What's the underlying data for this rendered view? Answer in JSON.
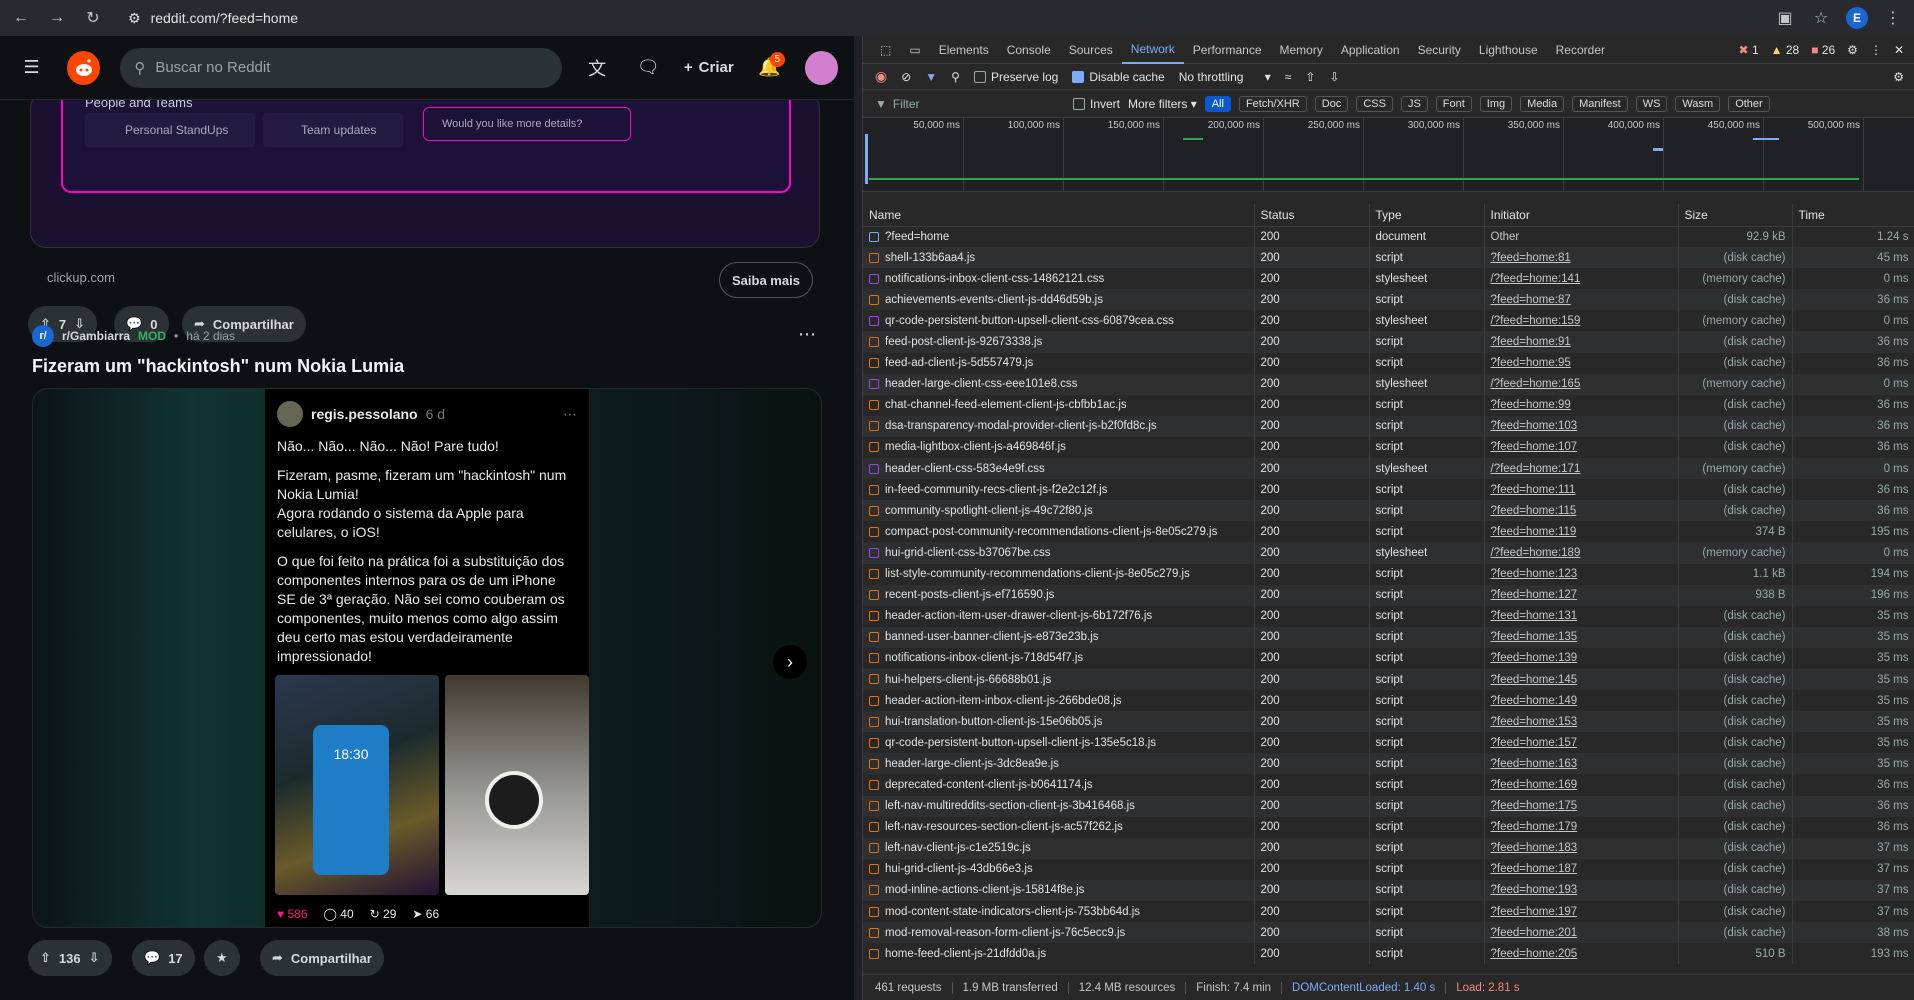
{
  "browser": {
    "url": "reddit.com/?feed=home",
    "profile_initial": "E"
  },
  "reddit": {
    "search_placeholder": "Buscar no Reddit",
    "create_label": "Criar",
    "notif_count": "5",
    "ad": {
      "section_label": "People and Teams",
      "item1": "Personal StandUps",
      "item2": "Team updates",
      "chat_placeholder": "Would you like more details?",
      "domain": "clickup.com",
      "cta": "Saiba mais"
    },
    "ad_actions": {
      "votes": "7",
      "comments": "0",
      "share": "Compartilhar"
    },
    "post": {
      "subreddit": "r/Gambiarra",
      "mod_tag": "MOD",
      "time": "há 2 dias",
      "title": "Fizeram um \"hackintosh\" num Nokia Lumia",
      "tweet_user": "regis.pessolano",
      "tweet_age": "6 d",
      "tweet_p1": "Não... Não... Não... Não! Pare tudo!",
      "tweet_p2": "Fizeram, pasme, fizeram um \"hackintosh\" num Nokia Lumia!",
      "tweet_p3": "Agora rodando o sistema da Apple para celulares, o iOS!",
      "tweet_p4": "O que foi feito na prática foi a substituição dos componentes internos para os de um iPhone SE de 3ª geração. Não sei como couberam os componentes, muito menos como algo assim deu certo mas estou verdadeiramente impressionado!",
      "phone_time": "18:30",
      "likes": "586",
      "replies": "40",
      "reposts": "29",
      "shares": "66",
      "votes": "136",
      "comments": "17",
      "share": "Compartilhar"
    }
  },
  "devtools": {
    "tabs": [
      "Elements",
      "Console",
      "Sources",
      "Network",
      "Performance",
      "Memory",
      "Application",
      "Security",
      "Lighthouse",
      "Recorder"
    ],
    "active_tab": "Network",
    "errors": "1",
    "warnings": "28",
    "issues": "26",
    "toolbar": {
      "preserve_log": "Preserve log",
      "disable_cache": "Disable cache",
      "throttling": "No throttling"
    },
    "filter": {
      "placeholder": "Filter",
      "invert": "Invert",
      "more_filters": "More filters",
      "types": [
        "All",
        "Fetch/XHR",
        "Doc",
        "CSS",
        "JS",
        "Font",
        "Img",
        "Media",
        "Manifest",
        "WS",
        "Wasm",
        "Other"
      ]
    },
    "timeline_ticks": [
      "50,000 ms",
      "100,000 ms",
      "150,000 ms",
      "200,000 ms",
      "250,000 ms",
      "300,000 ms",
      "350,000 ms",
      "400,000 ms",
      "450,000 ms",
      "500,000 ms"
    ],
    "columns": [
      "Name",
      "Status",
      "Type",
      "Initiator",
      "Size",
      "Time"
    ],
    "rows": [
      [
        "?feed=home",
        "200",
        "document",
        "Other",
        "92.9 kB",
        "1.24 s"
      ],
      [
        "shell-133b6aa4.js",
        "200",
        "script",
        "?feed=home:81",
        "(disk cache)",
        "45 ms"
      ],
      [
        "notifications-inbox-client-css-14862121.css",
        "200",
        "stylesheet",
        "/?feed=home:141",
        "(memory cache)",
        "0 ms"
      ],
      [
        "achievements-events-client-js-dd46d59b.js",
        "200",
        "script",
        "?feed=home:87",
        "(disk cache)",
        "36 ms"
      ],
      [
        "qr-code-persistent-button-upsell-client-css-60879cea.css",
        "200",
        "stylesheet",
        "/?feed=home:159",
        "(memory cache)",
        "0 ms"
      ],
      [
        "feed-post-client-js-92673338.js",
        "200",
        "script",
        "?feed=home:91",
        "(disk cache)",
        "36 ms"
      ],
      [
        "feed-ad-client-js-5d557479.js",
        "200",
        "script",
        "?feed=home:95",
        "(disk cache)",
        "36 ms"
      ],
      [
        "header-large-client-css-eee101e8.css",
        "200",
        "stylesheet",
        "/?feed=home:165",
        "(memory cache)",
        "0 ms"
      ],
      [
        "chat-channel-feed-element-client-js-cbfbb1ac.js",
        "200",
        "script",
        "?feed=home:99",
        "(disk cache)",
        "36 ms"
      ],
      [
        "dsa-transparency-modal-provider-client-js-b2f0fd8c.js",
        "200",
        "script",
        "?feed=home:103",
        "(disk cache)",
        "36 ms"
      ],
      [
        "media-lightbox-client-js-a469846f.js",
        "200",
        "script",
        "?feed=home:107",
        "(disk cache)",
        "36 ms"
      ],
      [
        "header-client-css-583e4e9f.css",
        "200",
        "stylesheet",
        "/?feed=home:171",
        "(memory cache)",
        "0 ms"
      ],
      [
        "in-feed-community-recs-client-js-f2e2c12f.js",
        "200",
        "script",
        "?feed=home:111",
        "(disk cache)",
        "36 ms"
      ],
      [
        "community-spotlight-client-js-49c72f80.js",
        "200",
        "script",
        "?feed=home:115",
        "(disk cache)",
        "36 ms"
      ],
      [
        "compact-post-community-recommendations-client-js-8e05c279.js",
        "200",
        "script",
        "?feed=home:119",
        "374 B",
        "195 ms"
      ],
      [
        "hui-grid-client-css-b37067be.css",
        "200",
        "stylesheet",
        "/?feed=home:189",
        "(memory cache)",
        "0 ms"
      ],
      [
        "list-style-community-recommendations-client-js-8e05c279.js",
        "200",
        "script",
        "?feed=home:123",
        "1.1 kB",
        "194 ms"
      ],
      [
        "recent-posts-client-js-ef716590.js",
        "200",
        "script",
        "?feed=home:127",
        "938 B",
        "196 ms"
      ],
      [
        "header-action-item-user-drawer-client-js-6b172f76.js",
        "200",
        "script",
        "?feed=home:131",
        "(disk cache)",
        "35 ms"
      ],
      [
        "banned-user-banner-client-js-e873e23b.js",
        "200",
        "script",
        "?feed=home:135",
        "(disk cache)",
        "35 ms"
      ],
      [
        "notifications-inbox-client-js-718d54f7.js",
        "200",
        "script",
        "?feed=home:139",
        "(disk cache)",
        "35 ms"
      ],
      [
        "hui-helpers-client-js-66688b01.js",
        "200",
        "script",
        "?feed=home:145",
        "(disk cache)",
        "35 ms"
      ],
      [
        "header-action-item-inbox-client-js-266bde08.js",
        "200",
        "script",
        "?feed=home:149",
        "(disk cache)",
        "35 ms"
      ],
      [
        "hui-translation-button-client-js-15e06b05.js",
        "200",
        "script",
        "?feed=home:153",
        "(disk cache)",
        "35 ms"
      ],
      [
        "qr-code-persistent-button-upsell-client-js-135e5c18.js",
        "200",
        "script",
        "?feed=home:157",
        "(disk cache)",
        "35 ms"
      ],
      [
        "header-large-client-js-3dc8ea9e.js",
        "200",
        "script",
        "?feed=home:163",
        "(disk cache)",
        "35 ms"
      ],
      [
        "deprecated-content-client-js-b0641174.js",
        "200",
        "script",
        "?feed=home:169",
        "(disk cache)",
        "36 ms"
      ],
      [
        "left-nav-multireddits-section-client-js-3b416468.js",
        "200",
        "script",
        "?feed=home:175",
        "(disk cache)",
        "36 ms"
      ],
      [
        "left-nav-resources-section-client-js-ac57f262.js",
        "200",
        "script",
        "?feed=home:179",
        "(disk cache)",
        "36 ms"
      ],
      [
        "left-nav-client-js-c1e2519c.js",
        "200",
        "script",
        "?feed=home:183",
        "(disk cache)",
        "37 ms"
      ],
      [
        "hui-grid-client-js-43db66e3.js",
        "200",
        "script",
        "?feed=home:187",
        "(disk cache)",
        "37 ms"
      ],
      [
        "mod-inline-actions-client-js-15814f8e.js",
        "200",
        "script",
        "?feed=home:193",
        "(disk cache)",
        "37 ms"
      ],
      [
        "mod-content-state-indicators-client-js-753bb64d.js",
        "200",
        "script",
        "?feed=home:197",
        "(disk cache)",
        "37 ms"
      ],
      [
        "mod-removal-reason-form-client-js-76c5ecc9.js",
        "200",
        "script",
        "?feed=home:201",
        "(disk cache)",
        "38 ms"
      ],
      [
        "home-feed-client-js-21dfdd0a.js",
        "200",
        "script",
        "?feed=home:205",
        "510 B",
        "193 ms"
      ]
    ],
    "status": {
      "requests": "461 requests",
      "transferred": "1.9 MB transferred",
      "resources": "12.4 MB resources",
      "finish": "Finish: 7.4 min",
      "dcl": "DOMContentLoaded: 1.40 s",
      "load": "Load: 2.81 s"
    }
  }
}
